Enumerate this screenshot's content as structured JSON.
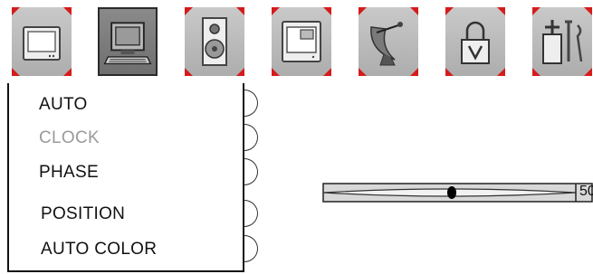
{
  "toolbar": {
    "icons": [
      {
        "name": "monitor-icon"
      },
      {
        "name": "computer-icon",
        "selected": true
      },
      {
        "name": "speaker-icon"
      },
      {
        "name": "picture-in-picture-icon"
      },
      {
        "name": "satellite-dish-icon"
      },
      {
        "name": "lock-icon"
      },
      {
        "name": "tools-icon"
      }
    ],
    "accent_color": "#d51b1b"
  },
  "menu": {
    "items": [
      {
        "label": "AUTO",
        "enabled": true
      },
      {
        "label": "CLOCK",
        "enabled": false
      },
      {
        "label": "PHASE",
        "enabled": true
      },
      {
        "label": "POSITION",
        "enabled": true
      },
      {
        "label": "AUTO COLOR",
        "enabled": true
      }
    ]
  },
  "slider": {
    "value_label": "50",
    "value_fraction": 0.5
  }
}
